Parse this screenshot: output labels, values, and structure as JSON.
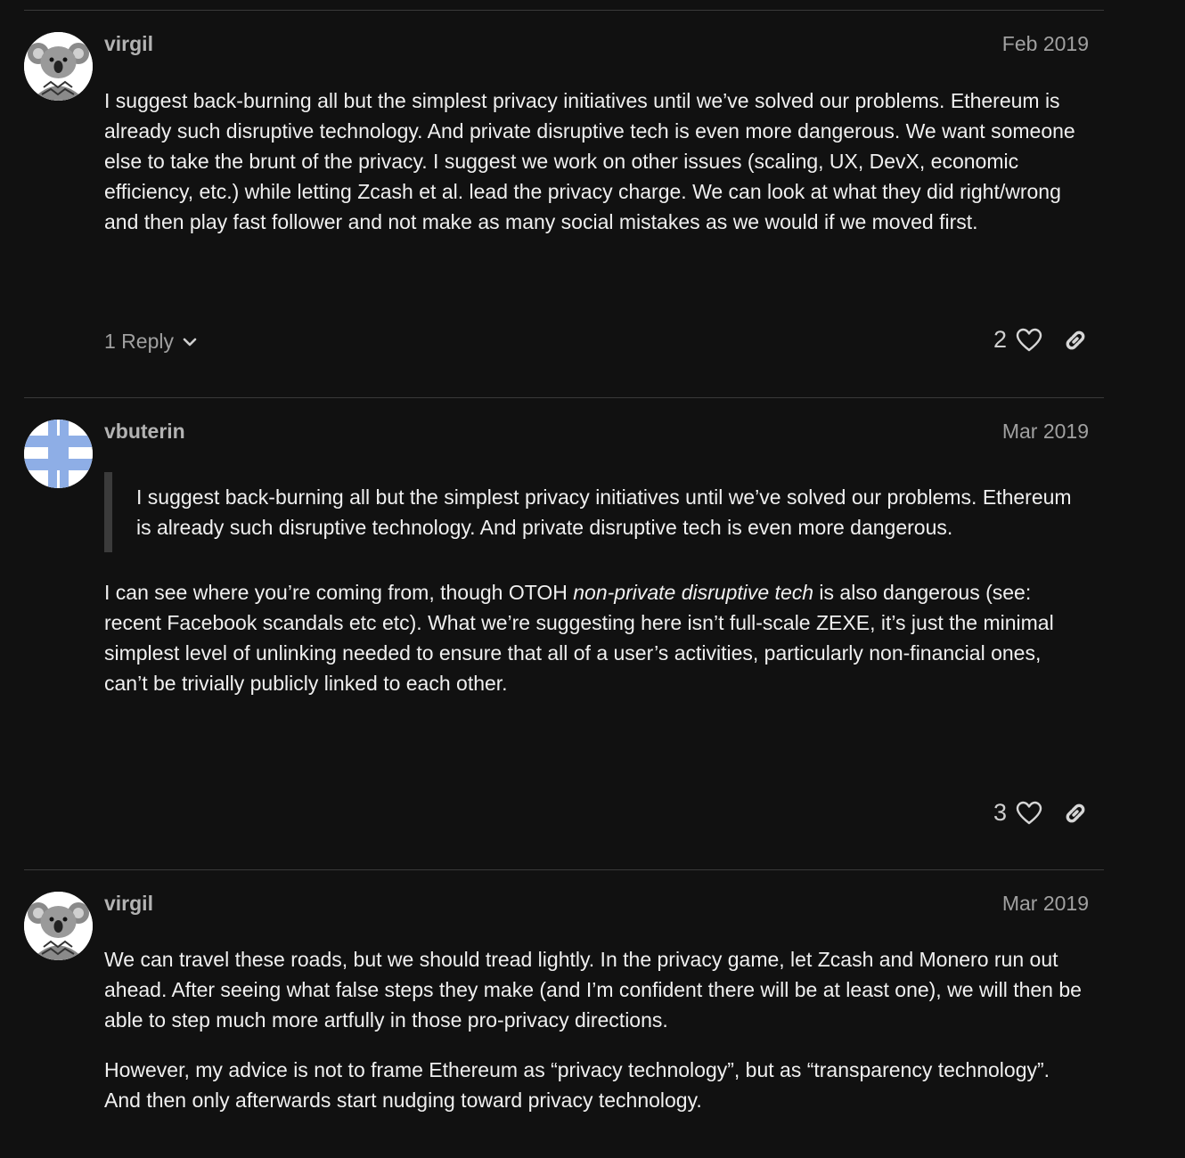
{
  "posts": [
    {
      "username": "virgil",
      "date": "Feb 2019",
      "avatar_icon": "koala-avatar-icon",
      "paragraphs": [
        "I suggest back-burning all but the simplest privacy initiatives until we’ve solved our problems. Ethereum is already such disruptive technology. And private disruptive tech is even more dangerous. We want someone else to take the brunt of the privacy. I suggest we work on other issues (scaling, UX, DevX, economic efficiency, etc.) while letting Zcash et al. lead the privacy charge. We can look at what they did right/wrong and then play fast follower and not make as many social mistakes as we would if we moved first."
      ],
      "replies_label": "1 Reply",
      "likes": "2"
    },
    {
      "username": "vbuterin",
      "date": "Mar 2019",
      "avatar_icon": "blue-cross-avatar-icon",
      "quote": "I suggest back-burning all but the simplest privacy initiatives until we’ve solved our problems. Ethereum is already such disruptive technology. And private disruptive tech is even more dangerous.",
      "reply_before_em": "I can see where you’re coming from, though OTOH ",
      "reply_em": "non-private disruptive tech",
      "reply_after_em": " is also dangerous (see: recent Facebook scandals etc etc). What we’re suggesting here isn’t full-scale ZEXE, it’s just the minimal simplest level of unlinking needed to ensure that all of a user’s activities, particularly non-financial ones, can’t be trivially publicly linked to each other.",
      "likes": "3"
    },
    {
      "username": "virgil",
      "date": "Mar 2019",
      "avatar_icon": "koala-avatar-icon",
      "paragraphs": [
        "We can travel these roads, but we should tread lightly. In the privacy game, let Zcash and Monero run out ahead. After seeing what false steps they make (and I’m confident there will be at least one), we will then be able to step much more artfully in those pro-privacy directions.",
        "However, my advice is not to frame Ethereum as “privacy technology”, but as “transparency technology”. And then only afterwards start nudging toward privacy technology."
      ]
    }
  ],
  "colors": {
    "background": "#111111",
    "divider": "#3a3a3a",
    "muted": "#a0a0a0",
    "text": "#f0f0f0"
  }
}
